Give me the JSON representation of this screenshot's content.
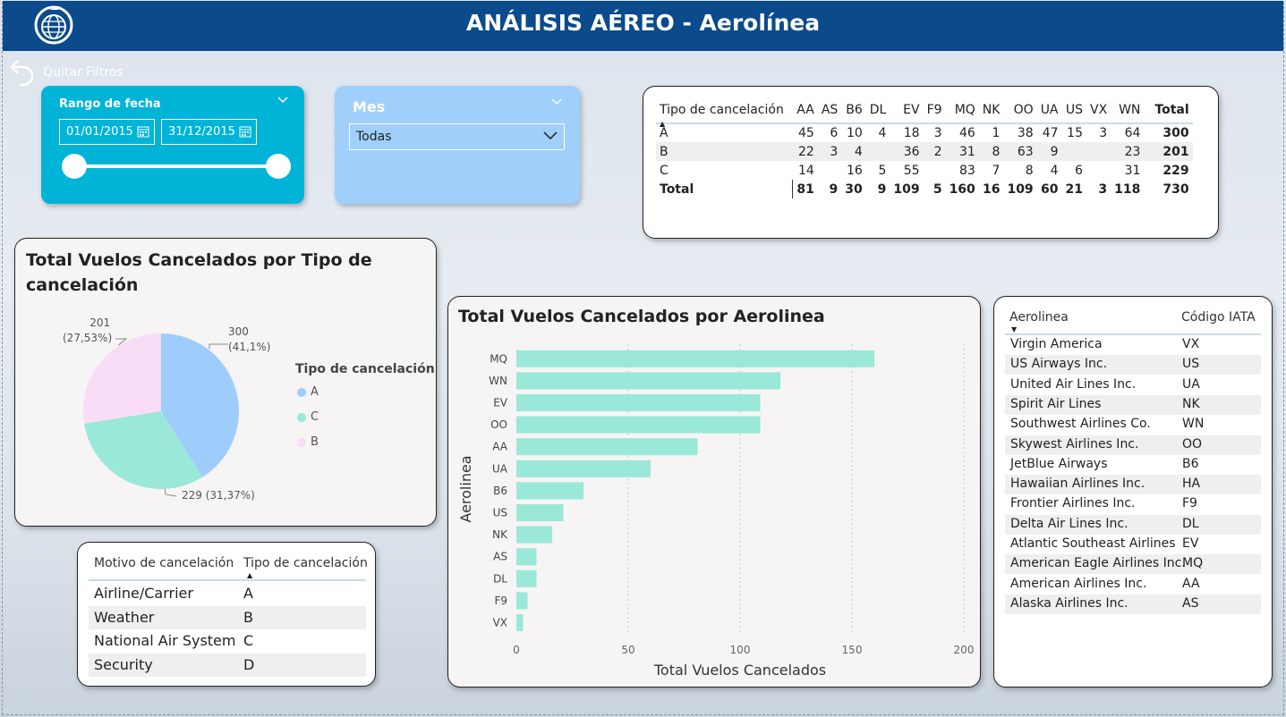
{
  "header": {
    "title": "ANÁLISIS AÉREO - Aerolínea"
  },
  "toolbar": {
    "clear_filters_label": "Quitar Filtros"
  },
  "date_slicer": {
    "label": "Rango de fecha",
    "start": "01/01/2015",
    "end": "31/12/2015",
    "range_fraction": [
      0,
      1
    ]
  },
  "month_slicer": {
    "label": "Mes",
    "selected": "Todas"
  },
  "matrix": {
    "row_header": "Tipo de cancelación",
    "columns": [
      "AA",
      "AS",
      "B6",
      "DL",
      "EV",
      "F9",
      "MQ",
      "NK",
      "OO",
      "UA",
      "US",
      "VX",
      "WN",
      "Total"
    ],
    "rows": [
      {
        "label": "A",
        "values": [
          "45",
          "6",
          "10",
          "4",
          "18",
          "3",
          "46",
          "1",
          "38",
          "47",
          "15",
          "3",
          "64",
          "300"
        ]
      },
      {
        "label": "B",
        "values": [
          "22",
          "3",
          "4",
          "",
          "36",
          "2",
          "31",
          "8",
          "63",
          "9",
          "",
          "",
          "23",
          "201"
        ]
      },
      {
        "label": "C",
        "values": [
          "14",
          "",
          "16",
          "5",
          "55",
          "",
          "83",
          "7",
          "8",
          "4",
          "6",
          "",
          "31",
          "229"
        ]
      }
    ],
    "total_row": {
      "label": "Total",
      "values": [
        "81",
        "9",
        "30",
        "9",
        "109",
        "5",
        "160",
        "16",
        "109",
        "60",
        "21",
        "3",
        "118",
        "730"
      ]
    }
  },
  "pie_card": {
    "title_line1": "Total Vuelos Cancelados por Tipo de",
    "title_line2": "cancelación",
    "legend_title": "Tipo de cancelación",
    "labels": {
      "a_value": "300",
      "a_pct": "(41,1%)",
      "b_value": "201",
      "b_pct": "(27,53%)",
      "c_text": "229 (31,37%)"
    },
    "legend": [
      {
        "label": "A",
        "color": "#9fcdfb"
      },
      {
        "label": "C",
        "color": "#9ae8d8"
      },
      {
        "label": "B",
        "color": "#f9dcf6"
      }
    ]
  },
  "reasons_table": {
    "col1": "Motivo de cancelación",
    "col2": "Tipo de cancelación",
    "rows": [
      {
        "reason": "Airline/Carrier",
        "type": "A"
      },
      {
        "reason": "Weather",
        "type": "B"
      },
      {
        "reason": "National Air System",
        "type": "C"
      },
      {
        "reason": "Security",
        "type": "D"
      }
    ]
  },
  "chart_data": [
    {
      "type": "pie",
      "title": "Total Vuelos Cancelados por Tipo de cancelación",
      "legend_title": "Tipo de cancelación",
      "categories": [
        "A",
        "C",
        "B"
      ],
      "values": [
        300,
        229,
        201
      ],
      "percent_labels": [
        "41,1%",
        "31,37%",
        "27,53%"
      ],
      "colors": [
        "#9fcdfb",
        "#9ae8d8",
        "#f9dcf6"
      ],
      "legend_position": "right"
    },
    {
      "type": "bar",
      "orientation": "horizontal",
      "title": "Total Vuelos Cancelados por Aerolinea",
      "xlabel": "Total Vuelos Cancelados",
      "ylabel": "Aerolinea",
      "categories": [
        "MQ",
        "WN",
        "EV",
        "OO",
        "AA",
        "UA",
        "B6",
        "US",
        "NK",
        "AS",
        "DL",
        "F9",
        "VX"
      ],
      "values": [
        160,
        118,
        109,
        109,
        81,
        60,
        30,
        21,
        16,
        9,
        9,
        5,
        3
      ],
      "xlim": [
        0,
        200
      ],
      "xticks": [
        0,
        50,
        100,
        150,
        200
      ],
      "grid": true,
      "color": "#9ae8d8"
    }
  ],
  "airlines_table": {
    "col1": "Aerolinea",
    "col2": "Código IATA",
    "rows": [
      {
        "name": "Virgin America",
        "code": "VX"
      },
      {
        "name": "US Airways Inc.",
        "code": "US"
      },
      {
        "name": "United Air Lines Inc.",
        "code": "UA"
      },
      {
        "name": "Spirit Air Lines",
        "code": "NK"
      },
      {
        "name": "Southwest Airlines Co.",
        "code": "WN"
      },
      {
        "name": "Skywest Airlines Inc.",
        "code": "OO"
      },
      {
        "name": "JetBlue Airways",
        "code": "B6"
      },
      {
        "name": "Hawaiian Airlines Inc.",
        "code": "HA"
      },
      {
        "name": "Frontier Airlines Inc.",
        "code": "F9"
      },
      {
        "name": "Delta Air Lines Inc.",
        "code": "DL"
      },
      {
        "name": "Atlantic Southeast Airlines",
        "code": "EV"
      },
      {
        "name": "American Eagle Airlines Inc.",
        "code": "MQ"
      },
      {
        "name": "American Airlines Inc.",
        "code": "AA"
      },
      {
        "name": "Alaska Airlines Inc.",
        "code": "AS"
      }
    ]
  }
}
